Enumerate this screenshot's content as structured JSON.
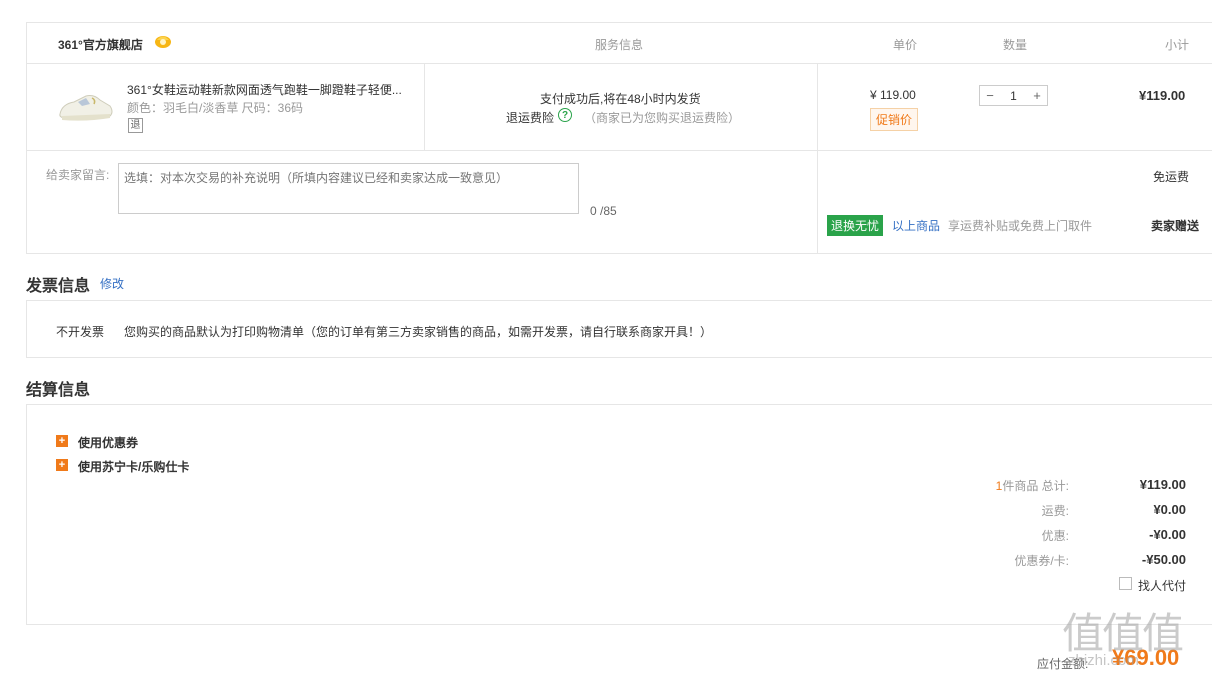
{
  "header": {
    "shop_name": "361°官方旗舰店",
    "col_service": "服务信息",
    "col_price": "单价",
    "col_qty": "数量",
    "col_subtotal": "小计"
  },
  "item": {
    "name": "361°女鞋运动鞋新款网面透气跑鞋一脚蹬鞋子轻便...",
    "spec": "颜色：羽毛白/淡香草   尺码：36码",
    "return_tag": "退",
    "service_line1": "支付成功后,将在48小时内发货",
    "service_insurance": "退运费险",
    "service_insurance_help": "?",
    "service_insurance_note": "（商家已为您购买退运费险）",
    "unit_price": "¥ 119.00",
    "promo_label": "促销价",
    "qty_minus": "−",
    "qty": "1",
    "qty_plus": "+",
    "subtotal": "¥119.00"
  },
  "message": {
    "label": "给卖家留言:",
    "placeholder": "选填：对本次交易的补充说明（所填内容建议已经和卖家达成一致意见）",
    "counter": "0 /85"
  },
  "shipping": {
    "free_shipping": "免运费",
    "return_badge": "退换无忧",
    "return_link": "以上商品",
    "return_desc": "享运费补贴或免费上门取件",
    "seller_gift": "卖家赠送"
  },
  "invoice": {
    "title": "发票信息",
    "edit": "修改",
    "type": "不开发票",
    "desc": "您购买的商品默认为打印购物清单（您的订单有第三方卖家销售的商品，如需开发票，请自行联系商家开具！）"
  },
  "settlement": {
    "title": "结算信息",
    "options": [
      "使用优惠券",
      "使用苏宁卡/乐购仕卡"
    ],
    "summary": [
      {
        "count": "1",
        "label": "件商品 总计:",
        "value": "¥119.00"
      },
      {
        "count": "",
        "label": "运费:",
        "value": "¥0.00"
      },
      {
        "count": "",
        "label": "优惠:",
        "value": "-¥0.00"
      },
      {
        "count": "",
        "label": "优惠券/卡:",
        "value": "-¥50.00"
      }
    ],
    "proxy_pay": "找人代付",
    "pay_label": "应付金额:",
    "pay_amount": "¥69.00"
  },
  "watermark": {
    "logo": "值值值",
    "url": "zhizhi.com"
  },
  "colors": {
    "accent_orange": "#f07a1a",
    "green": "#2aa34a",
    "link_blue": "#3570c4"
  }
}
